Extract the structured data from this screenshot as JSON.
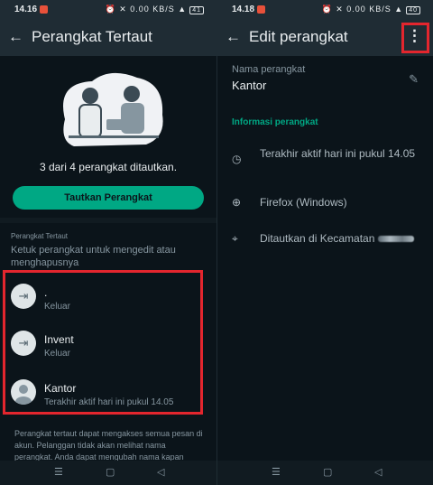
{
  "left": {
    "status": {
      "time": "14.16",
      "icons": "⏰ ✕ 0.00 KB/S ▲",
      "battery": "41"
    },
    "appbar": {
      "back": "←",
      "title": "Perangkat Tertaut"
    },
    "linked_count": "3 dari 4 perangkat ditautkan.",
    "link_button": "Tautkan Perangkat",
    "section_label": "Perangkat Tertaut",
    "section_hint": "Ketuk perangkat untuk mengedit atau menghapusnya",
    "devices": [
      {
        "name": ".",
        "status": "Keluar",
        "icon": "logout-icon"
      },
      {
        "name": "Invent",
        "status": "Keluar",
        "icon": "logout-icon"
      },
      {
        "name": "Kantor",
        "status": "Terakhir aktif hari ini pukul 14.05",
        "icon": "avatar-icon"
      }
    ],
    "footer": "Perangkat tertaut dapat mengakses semua pesan di akun. Pelanggan tidak akan melihat nama perangkat. Anda dapat mengubah nama kapan"
  },
  "right": {
    "status": {
      "time": "14.18",
      "icons": "⏰ ✕ 0.00 KB/S ▲",
      "battery": "40"
    },
    "appbar": {
      "back": "←",
      "title": "Edit perangkat",
      "more": "⋮"
    },
    "name_label": "Nama perangkat",
    "name_value": "Kantor",
    "info_header": "Informasi perangkat",
    "info": {
      "last_active": "Terakhir aktif hari ini pukul 14.05",
      "browser": "Firefox (Windows)",
      "location": "Ditautkan di Kecamatan"
    }
  },
  "colors": {
    "accent": "#00a884",
    "highlight": "#e3262e",
    "background": "#0b141a",
    "bar": "#1f2c34"
  },
  "navbar": {
    "menu": "☰",
    "home": "▢",
    "back": "◁"
  }
}
